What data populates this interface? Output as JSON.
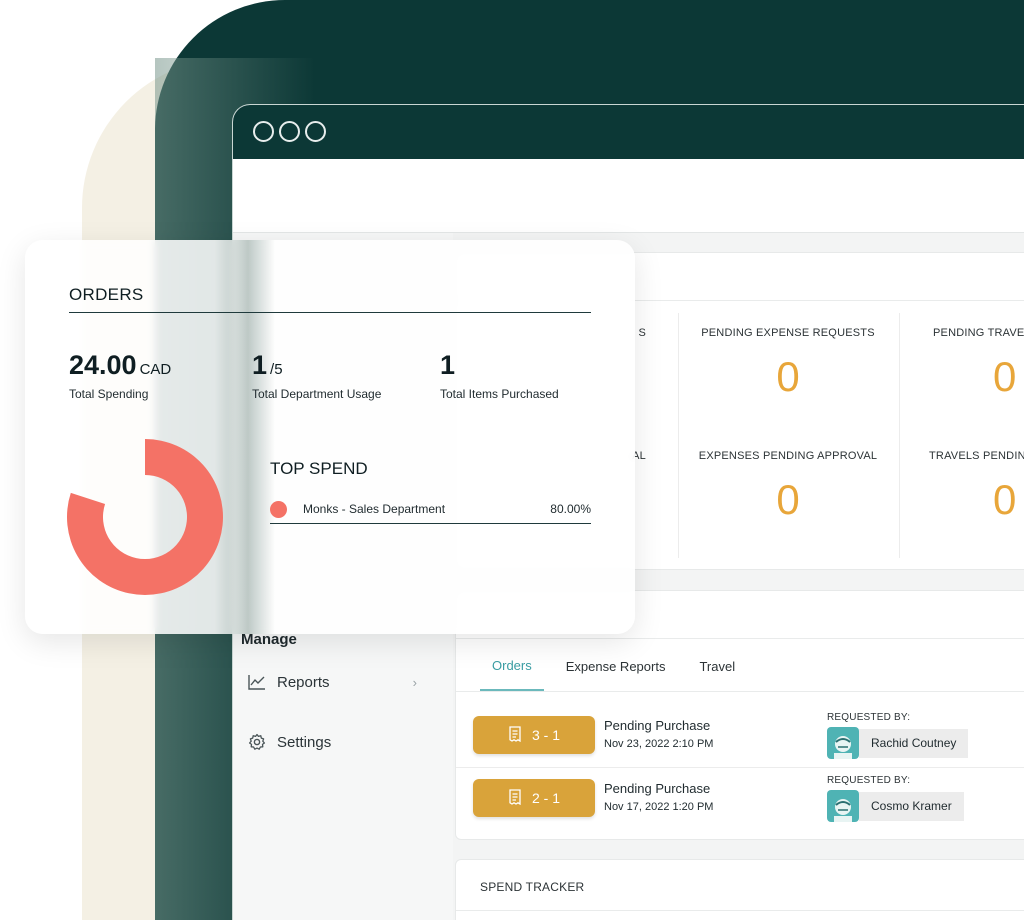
{
  "browser": {
    "dots": [
      "window-dot-1",
      "window-dot-2",
      "window-dot-3"
    ]
  },
  "sidebar": {
    "heading": "Manage",
    "items": [
      {
        "label": "Reports",
        "icon": "chart-line-icon",
        "has_chevron": true
      },
      {
        "label": "Settings",
        "icon": "gear-icon",
        "has_chevron": false
      }
    ]
  },
  "stats": {
    "partial_labels": [
      "S",
      "AL"
    ],
    "items": [
      {
        "label": "PENDING EXPENSE REQUESTS",
        "value": "0"
      },
      {
        "label": "PENDING TRAVEL",
        "value": "0"
      },
      {
        "label": "EXPENSES PENDING APPROVAL",
        "value": "0"
      },
      {
        "label": "TRAVELS PENDING",
        "value": "0"
      }
    ],
    "accent_color": "#e8a63a"
  },
  "orders_panel": {
    "tabs": [
      {
        "label": "Orders",
        "active": true
      },
      {
        "label": "Expense Reports",
        "active": false
      },
      {
        "label": "Travel",
        "active": false
      }
    ],
    "rows": [
      {
        "id": "3 - 1",
        "status": "Pending Purchase",
        "date": "Nov 23, 2022 2:10 PM",
        "requested_by_label": "REQUESTED BY:",
        "requester": "Rachid Coutney"
      },
      {
        "id": "2 - 1",
        "status": "Pending Purchase",
        "date": "Nov 17, 2022 1:20 PM",
        "requested_by_label": "REQUESTED BY:",
        "requester": "Cosmo Kramer"
      }
    ],
    "badge_color": "#d9a33a"
  },
  "spend_tracker": {
    "title": "SPEND TRACKER"
  },
  "orders_card": {
    "title": "ORDERS",
    "kpis": [
      {
        "number": "24.00",
        "unit": "CAD",
        "caption": "Total Spending"
      },
      {
        "number": "1",
        "unit": "/5",
        "caption": "Total Department Usage"
      },
      {
        "number": "1",
        "unit": "",
        "caption": "Total Items Purchased"
      }
    ],
    "top_spend": {
      "title": "TOP SPEND",
      "entries": [
        {
          "name": "Monks - Sales Department",
          "percent": "80.00%",
          "share": 0.8,
          "color": "#f47266"
        }
      ]
    }
  }
}
